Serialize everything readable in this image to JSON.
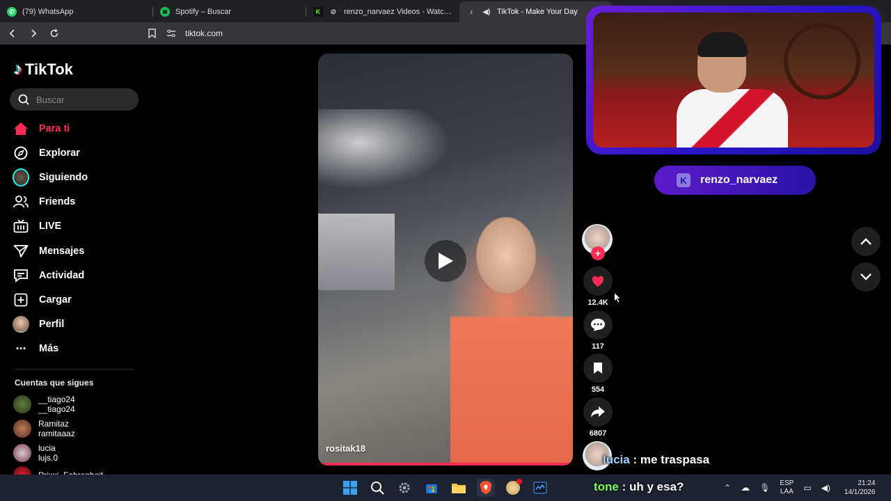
{
  "browser": {
    "tabs": [
      {
        "label": "(79) WhatsApp",
        "icon": "whatsapp-icon",
        "color": "#25d366"
      },
      {
        "label": "Spotify – Buscar",
        "icon": "spotify-icon",
        "color": "#1db954"
      },
      {
        "label": "renzo_narvaez Videos - Watch On",
        "icon": "kick-icon",
        "color": "#53fc18"
      },
      {
        "label": "TikTok - Make Your Day",
        "icon": "tiktok-icon",
        "color": "#ffffff"
      }
    ],
    "url": "tiktok.com"
  },
  "tiktok": {
    "logo_text": "TikTok",
    "search_placeholder": "Buscar",
    "nav": [
      {
        "label": "Para ti",
        "icon": "home-icon",
        "active": true
      },
      {
        "label": "Explorar",
        "icon": "compass-icon"
      },
      {
        "label": "Siguiendo",
        "icon": "following-avatar-icon"
      },
      {
        "label": "Friends",
        "icon": "friends-icon"
      },
      {
        "label": "LIVE",
        "icon": "live-icon"
      },
      {
        "label": "Mensajes",
        "icon": "messages-icon"
      },
      {
        "label": "Actividad",
        "icon": "activity-icon"
      },
      {
        "label": "Cargar",
        "icon": "upload-icon"
      },
      {
        "label": "Perfil",
        "icon": "profile-avatar-icon"
      },
      {
        "label": "Más",
        "icon": "more-icon"
      }
    ],
    "following_title": "Cuentas que sigues",
    "following": [
      {
        "name": "__tiago24",
        "handle": "__tiago24"
      },
      {
        "name": "Ramitaz",
        "handle": "ramitaaaz"
      },
      {
        "name": "lucia",
        "handle": "lujs.0"
      },
      {
        "name": "Prixxi_Fahrenheit...",
        "handle": ""
      }
    ],
    "video": {
      "author": "rositak18",
      "likes": "12.4K",
      "comments": "117",
      "saves": "554",
      "shares": "6807"
    }
  },
  "stream": {
    "channel": "renzo_narvaez",
    "chat_line1": {
      "user": "lucia",
      "sep": " : ",
      "msg": "me traspasa"
    },
    "chat_line2": {
      "user": "tone",
      "sep": " : ",
      "msg": "uh y esa?"
    },
    "accent": "#5b1cc9"
  },
  "taskbar": {
    "lang": "ESP",
    "region": "LAA",
    "time": "21:24",
    "date": "14/1/2026"
  }
}
